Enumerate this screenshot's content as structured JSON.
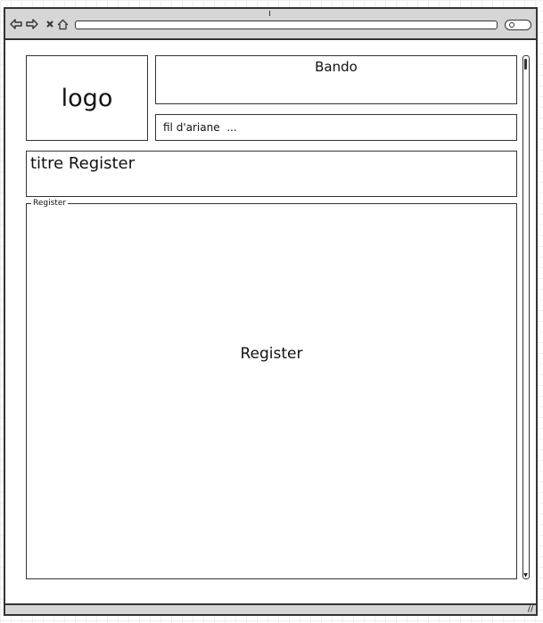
{
  "browser": {
    "nav_icons": [
      "back-icon",
      "forward-icon",
      "close-icon",
      "home-icon"
    ],
    "url": "",
    "search_icon": "search-icon"
  },
  "header": {
    "logo_text": "logo",
    "banner_text": "Bando",
    "breadcrumb_text": "fil d'ariane  ..."
  },
  "title": {
    "text": "titre Register"
  },
  "register_panel": {
    "legend": "Register",
    "content": "Register"
  },
  "colors": {
    "toolbar_bg": "#d6d6d6",
    "border": "#333333"
  }
}
